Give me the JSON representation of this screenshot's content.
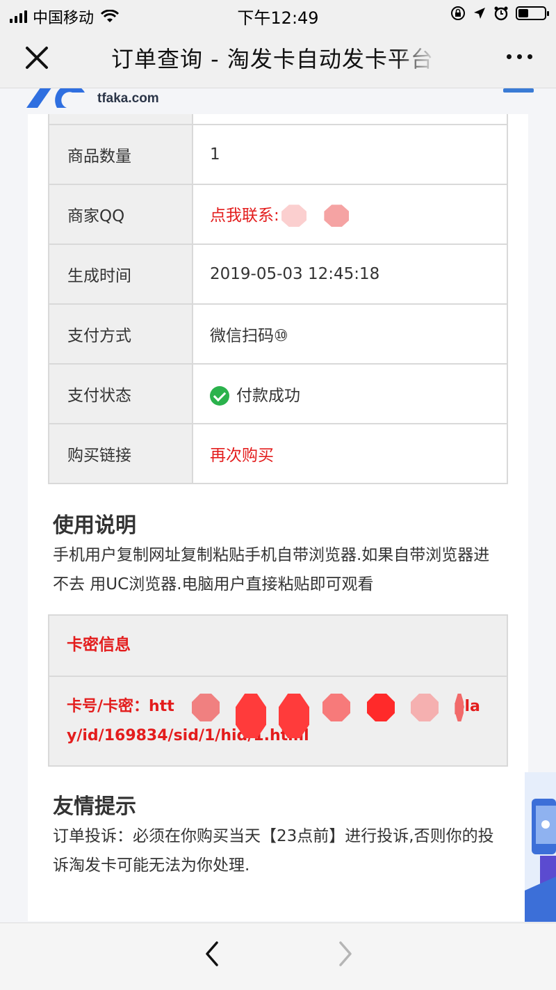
{
  "status_bar": {
    "carrier": "中国移动",
    "time": "下午12:49",
    "battery_level": 0.38
  },
  "nav_bar": {
    "title": "订单查询 - 淘发卡自动发卡平台"
  },
  "site": {
    "logo_text": "tfaka.com"
  },
  "order_table": [
    {
      "label": "商品数量",
      "value": "1"
    },
    {
      "label": "商家QQ",
      "value": "点我联系:"
    },
    {
      "label": "生成时间",
      "value": "2019-05-03 12:45:18"
    },
    {
      "label": "支付方式",
      "value": "微信扫码⑩"
    },
    {
      "label": "支付状态",
      "value": "付款成功"
    },
    {
      "label": "购买链接",
      "value": "再次购买"
    }
  ],
  "usage": {
    "title": "使用说明",
    "text": "手机用户复制网址复制粘贴手机自带浏览器.如果自带浏览器进不去 用UC浏览器.电脑用户直接粘贴即可观看"
  },
  "card_info": {
    "header": "卡密信息",
    "line1_prefix": "卡号/卡密：htt",
    "line1_suffix": "pla",
    "line2": "y/id/169834/sid/1/hid/1.html"
  },
  "tips": {
    "title": "友情提示",
    "text": "订单投诉：必须在你购买当天【23点前】进行投诉,否则你的投诉淘发卡可能无法为你处理."
  },
  "colors": {
    "accent_red": "#e31d1d",
    "success_green": "#2bb24c",
    "brand_blue": "#3a7bd5"
  }
}
